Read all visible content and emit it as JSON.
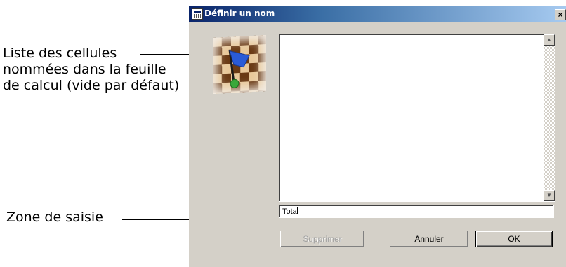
{
  "annotations": {
    "list_callout": "Liste des cellules nommées dans la feuille de calcul (vide par défaut)",
    "input_callout": "Zone de saisie"
  },
  "dialog": {
    "title": "Définir un nom",
    "close_glyph": "×",
    "title_icon": "sheet-icon",
    "image": "checkered-flag-icon",
    "list_items": [],
    "input_value": "Tota",
    "buttons": {
      "delete_label": "Supprimer",
      "cancel_label": "Annuler",
      "ok_label": "OK"
    },
    "colors": {
      "titlebar_start": "#0a246a",
      "titlebar_end": "#a6caf0",
      "face": "#d4d0c8"
    }
  }
}
